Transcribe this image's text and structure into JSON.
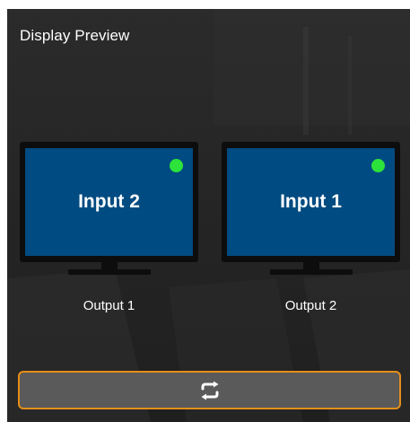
{
  "header": {
    "title": "Display Preview"
  },
  "monitors": [
    {
      "input_label": "Input 2",
      "output_label": "Output 1",
      "status": "active"
    },
    {
      "input_label": "Input 1",
      "output_label": "Output 2",
      "status": "active"
    }
  ],
  "swap_button": {
    "icon": "swap-arrows-icon"
  },
  "colors": {
    "background": "#262626",
    "screen": "#004b81",
    "status_led": "#2be33a",
    "button_border": "#e58e1a",
    "button_fill": "#5a5a5a"
  }
}
